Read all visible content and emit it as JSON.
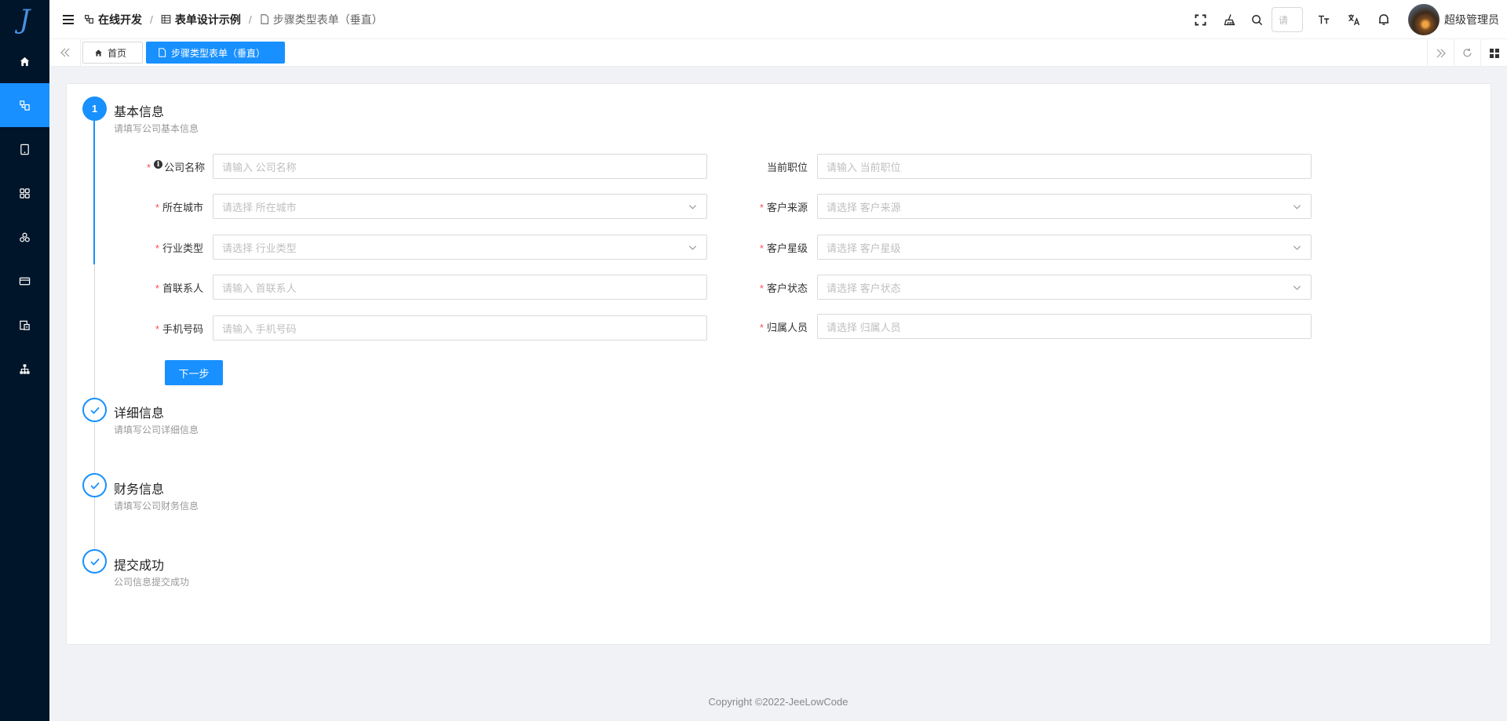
{
  "sidebar": {
    "logo": "J",
    "items": [
      {
        "icon": "home-icon"
      },
      {
        "icon": "online-dev-icon",
        "active": true
      },
      {
        "icon": "tablet-icon"
      },
      {
        "icon": "apps-icon"
      },
      {
        "icon": "components-icon"
      },
      {
        "icon": "card-icon"
      },
      {
        "icon": "report-icon"
      },
      {
        "icon": "org-chart-icon"
      }
    ]
  },
  "breadcrumb": {
    "items": [
      "在线开发",
      "表单设计示例",
      "步骤类型表单（垂直）"
    ],
    "separator": "/"
  },
  "header": {
    "search_placeholder": "请",
    "user_name": "超级管理员"
  },
  "tabs": {
    "items": [
      {
        "label": "首页",
        "active": false
      },
      {
        "label": "步骤类型表单（垂直）",
        "active": true
      }
    ]
  },
  "steps": [
    {
      "index": "1",
      "title": "基本信息",
      "desc": "请填写公司基本信息",
      "status": "current"
    },
    {
      "title": "详细信息",
      "desc": "请填写公司详细信息",
      "status": "wait"
    },
    {
      "title": "财务信息",
      "desc": "请填写公司财务信息",
      "status": "wait"
    },
    {
      "title": "提交成功",
      "desc": "公司信息提交成功",
      "status": "wait"
    }
  ],
  "form": {
    "left": [
      {
        "label": "公司名称",
        "placeholder": "请输入 公司名称",
        "required": true,
        "type": "input",
        "info": "i"
      },
      {
        "label": "所在城市",
        "placeholder": "请选择 所在城市",
        "required": true,
        "type": "select"
      },
      {
        "label": "行业类型",
        "placeholder": "请选择 行业类型",
        "required": true,
        "type": "select"
      },
      {
        "label": "首联系人",
        "placeholder": "请输入 首联系人",
        "required": true,
        "type": "input"
      },
      {
        "label": "手机号码",
        "placeholder": "请输入 手机号码",
        "required": true,
        "type": "input"
      }
    ],
    "right": [
      {
        "label": "当前职位",
        "placeholder": "请输入 当前职位",
        "required": false,
        "type": "input"
      },
      {
        "label": "客户来源",
        "placeholder": "请选择 客户来源",
        "required": true,
        "type": "select"
      },
      {
        "label": "客户星级",
        "placeholder": "请选择 客户星级",
        "required": true,
        "type": "select"
      },
      {
        "label": "客户状态",
        "placeholder": "请选择 客户状态",
        "required": true,
        "type": "select"
      },
      {
        "label": "归属人员",
        "placeholder": "请选择 归属人员",
        "required": true,
        "type": "input"
      }
    ],
    "required_mark": "*",
    "next_label": "下一步"
  },
  "footer": {
    "copyright": "Copyright ©2022-JeeLowCode"
  },
  "colors": {
    "primary": "#1890ff",
    "sidebar_bg": "#001529",
    "required": "#ff4d4f"
  }
}
